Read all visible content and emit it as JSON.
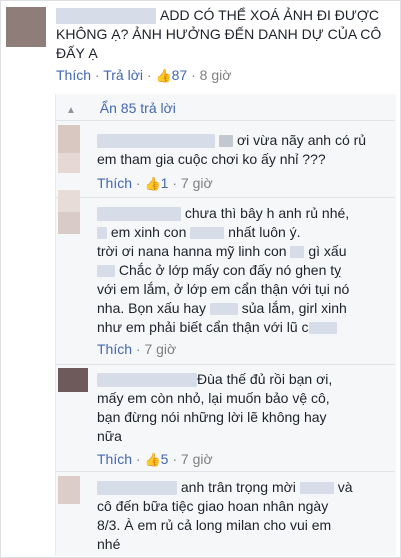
{
  "main_comment": {
    "text": "ADD CÓ THỂ XOÁ ẢNH ĐI ĐƯỢC KHÔNG Ạ? ẢNH HƯỞNG ĐẾN DANH DỰ CỦA CÔ ĐẤY Ạ",
    "like_label": "Thích",
    "reply_label": "Trả lời",
    "like_count": "87",
    "time": "8 giờ"
  },
  "replies_toggle": {
    "label": "Ẩn 85 trả lời"
  },
  "replies": [
    {
      "lines": [
        "ơi vừa nãy anh có rủ",
        "em tham gia cuộc chơi ko ấy nhỉ ???"
      ],
      "like_label": "Thích",
      "like_count": "1",
      "time": "7 giờ"
    },
    {
      "lines": [
        "chưa thì bây h anh rủ nhé,",
        "em xinh con",
        "nhất luôn ý.",
        "trời ơi nana hanna mỹ linh con",
        "gì xấu",
        "Chắc ở lớp mấy con đấy nó ghen tỵ",
        "với em lắm, ở lớp em cẩn thận với tụi nó",
        "nha. Bọn xấu hay",
        "sủa lắm, girl xinh",
        "như em phải biết cẩn thận với lũ c"
      ],
      "like_label": "Thích",
      "time": "7 giờ"
    },
    {
      "lines": [
        "Đùa thế đủ rồi bạn ơi,",
        "mấy em còn nhỏ, lại muốn bảo vệ cô,",
        "bạn đừng nói những lời lẽ không hay",
        "nữa"
      ],
      "like_label": "Thích",
      "like_count": "5",
      "time": "7 giờ"
    },
    {
      "lines": [
        "anh trân trọng mời",
        "và",
        "cô đến bữa tiệc giao hoan nhân ngày",
        "8/3. À em rủ cả long milan cho vui em",
        "nhé"
      ]
    }
  ],
  "separator": "·",
  "colors": {
    "link": "#4267b2",
    "muted": "#7f7f7f",
    "reply_bg": "#f6f7f9"
  },
  "icons": {
    "like": "thumbs-up-icon",
    "collapse": "up-triangle-icon"
  }
}
